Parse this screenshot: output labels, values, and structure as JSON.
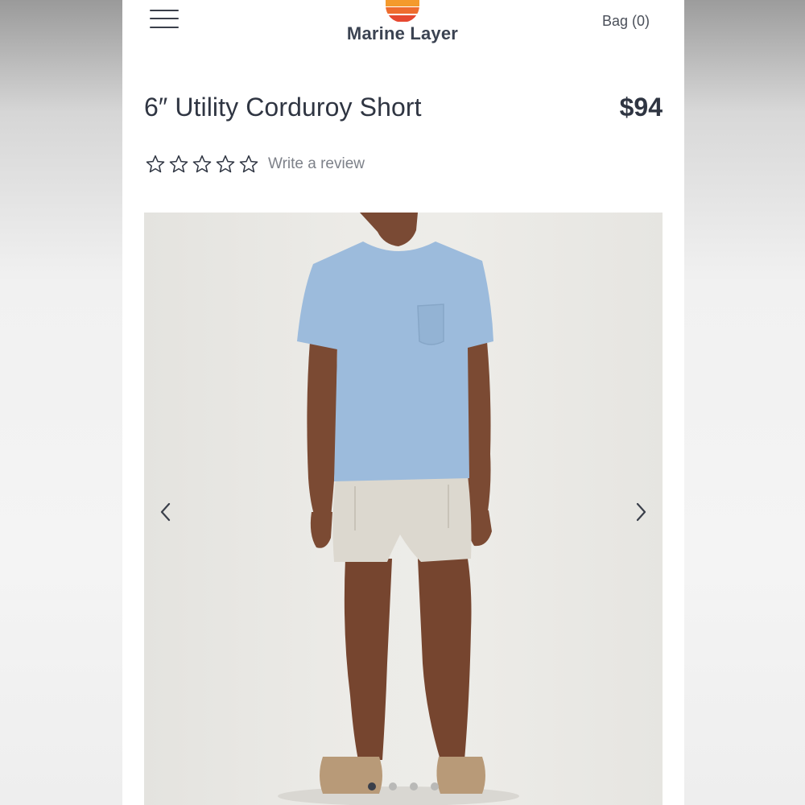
{
  "header": {
    "menu_icon": "hamburger-menu-icon",
    "logo": {
      "name": "Marine Layer",
      "stripe_colors": [
        "#f6c62f",
        "#f49a2c",
        "#ee6c2e",
        "#e64830"
      ]
    },
    "bag_label": "Bag (0)"
  },
  "product": {
    "title": "6″ Utility Corduroy Short",
    "price": "$94",
    "rating": {
      "value": 0,
      "max": 5,
      "review_link": "Write a review"
    }
  },
  "gallery": {
    "prev_icon": "chevron-left-icon",
    "next_icon": "chevron-right-icon",
    "slide_count": 4,
    "active_index": 0
  },
  "colors": {
    "text": "#2f3542",
    "muted": "#7d8189",
    "tee": "#9cbbdc",
    "shorts": "#dcd8cf"
  }
}
